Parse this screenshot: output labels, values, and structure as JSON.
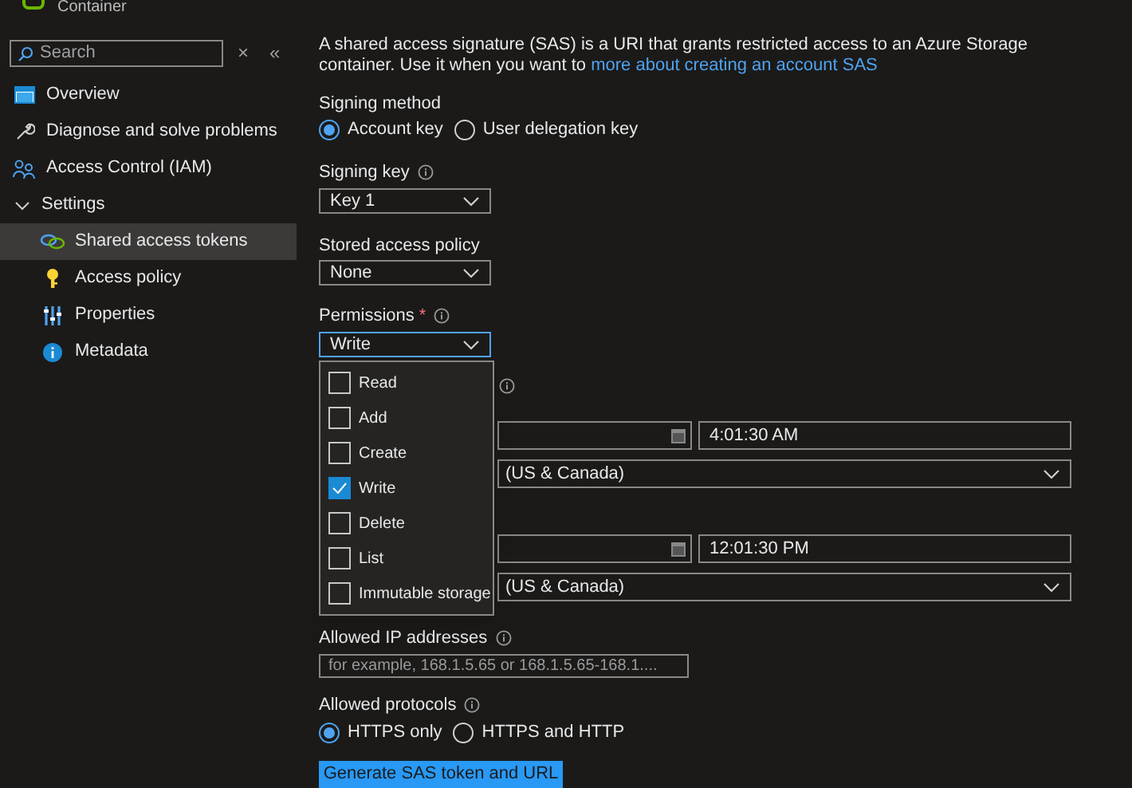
{
  "header": {
    "subtitle": "Container"
  },
  "sidebar": {
    "search": {
      "placeholder": "Search"
    },
    "close_glyph": "×",
    "collapse_glyph": "«",
    "items": [
      {
        "label": "Overview",
        "selected": false
      },
      {
        "label": "Diagnose and solve problems",
        "selected": false
      },
      {
        "label": "Access Control (IAM)",
        "selected": false
      },
      {
        "label": "Settings",
        "expanded": true,
        "children": [
          {
            "label": "Shared access tokens",
            "selected": true
          },
          {
            "label": "Access policy",
            "selected": false
          },
          {
            "label": "Properties",
            "selected": false
          },
          {
            "label": "Metadata",
            "selected": false
          }
        ]
      }
    ]
  },
  "intro": {
    "text": "A shared access signature (SAS) is a URI that grants restricted access to an Azure Storage container. Use it when you want to",
    "link": "more about creating an account SAS"
  },
  "signing_method": {
    "label": "Signing method",
    "options": [
      {
        "label": "Account key",
        "selected": true
      },
      {
        "label": "User delegation key",
        "selected": false
      }
    ]
  },
  "signing_key": {
    "label": "Signing key",
    "value": "Key 1"
  },
  "stored_access_policy": {
    "label": "Stored access policy",
    "value": "None"
  },
  "permissions": {
    "label": "Permissions",
    "required_mark": "*",
    "value": "Write",
    "expanded": true,
    "options": [
      {
        "label": "Read",
        "checked": false
      },
      {
        "label": "Add",
        "checked": false
      },
      {
        "label": "Create",
        "checked": false
      },
      {
        "label": "Write",
        "checked": true
      },
      {
        "label": "Delete",
        "checked": false
      },
      {
        "label": "List",
        "checked": false
      },
      {
        "label": "Immutable storage",
        "checked": false
      }
    ]
  },
  "start": {
    "time": "4:01:30 AM",
    "time_zone": "(US & Canada)"
  },
  "expiry": {
    "time": "12:01:30 PM",
    "time_zone": "(US & Canada)"
  },
  "allowed_ip": {
    "label": "Allowed IP addresses",
    "placeholder": "for example, 168.1.5.65 or 168.1.5.65-168.1...."
  },
  "allowed_protocols": {
    "label": "Allowed protocols",
    "options": [
      {
        "label": "HTTPS only",
        "selected": true
      },
      {
        "label": "HTTPS and HTTP",
        "selected": false
      }
    ]
  },
  "generate_button": "Generate SAS token and URL"
}
